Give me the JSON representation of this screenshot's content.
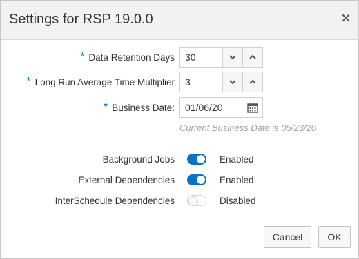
{
  "dialog": {
    "title": "Settings for RSP 19.0.0",
    "close_icon": "close-icon"
  },
  "fields": {
    "required_marker": "*",
    "retention": {
      "label": "Data Retention Days",
      "value": "30"
    },
    "multiplier": {
      "label": "Long Run Average Time Multiplier",
      "value": "3"
    },
    "business_date": {
      "label": "Business Date:",
      "value": "01/06/20",
      "hint": "Current Business Date is 05/23/20",
      "icon": "calendar-icon"
    }
  },
  "toggles": [
    {
      "label": "Background Jobs",
      "state": "Enabled",
      "on": true
    },
    {
      "label": "External Dependencies",
      "state": "Enabled",
      "on": true
    },
    {
      "label": "InterSchedule Dependencies",
      "state": "Disabled",
      "on": false
    }
  ],
  "buttons": {
    "cancel": "Cancel",
    "ok": "OK"
  },
  "colors": {
    "accent": "#0572ce",
    "header_bg": "#f2f2f2",
    "hint": "#a3a3a3"
  }
}
